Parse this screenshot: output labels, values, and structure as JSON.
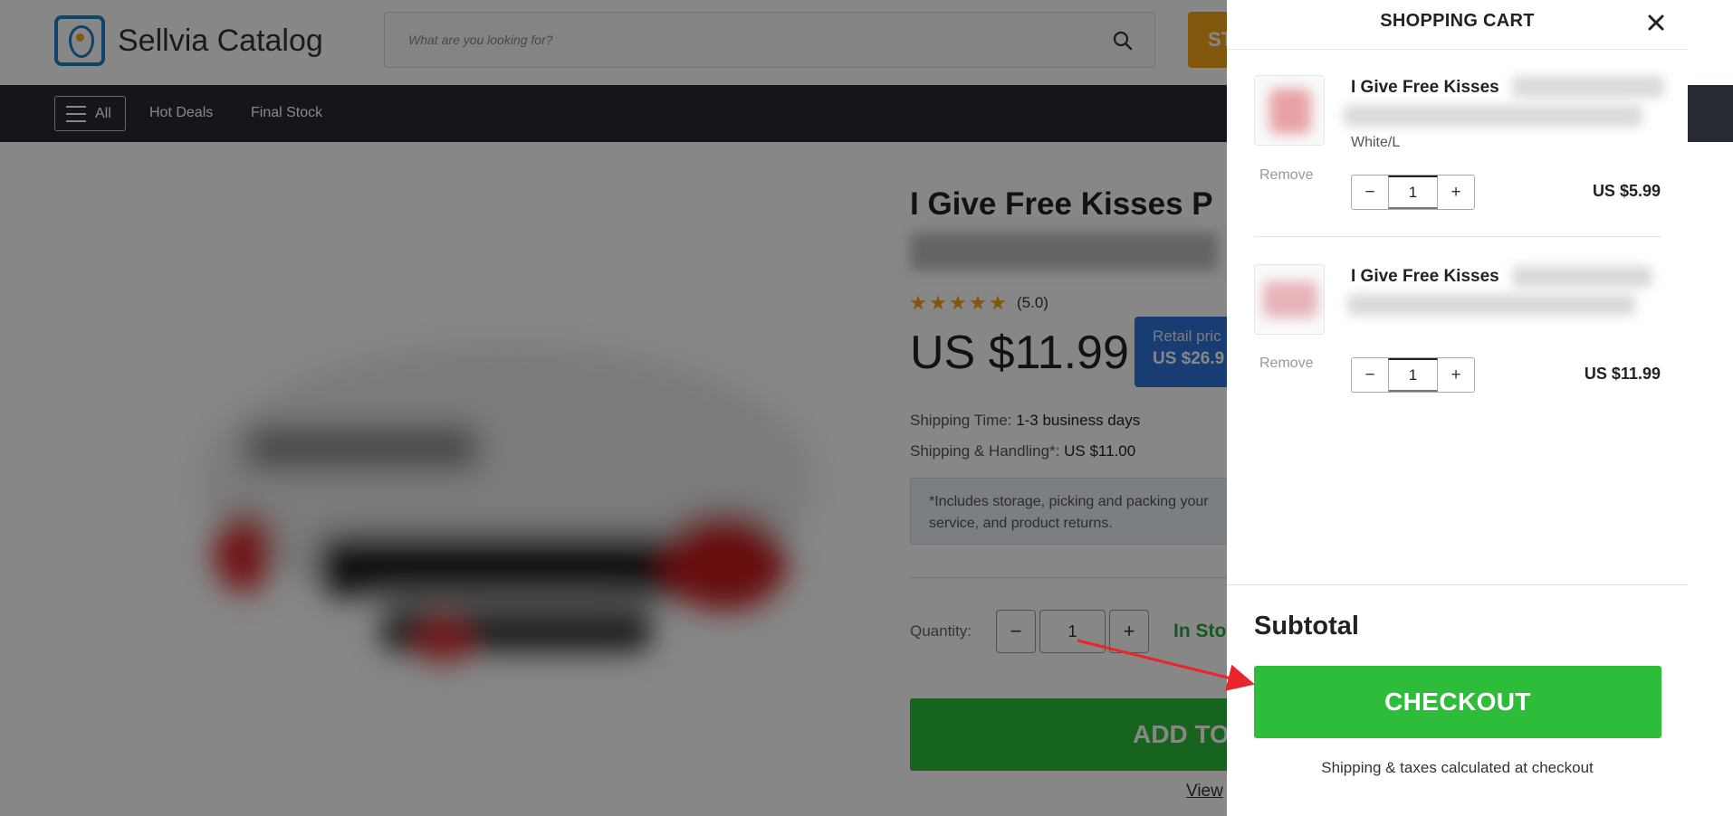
{
  "header": {
    "brand": "Sellvia Catalog",
    "search_placeholder": "What are you looking for?",
    "store_button_partial": "ST"
  },
  "nav": {
    "all_label": "All",
    "links": [
      "Hot Deals",
      "Final Stock"
    ]
  },
  "product": {
    "title_visible": "I Give Free Kisses P",
    "rating": "(5.0)",
    "stars": 5,
    "price": "US $11.99",
    "retail_label": "Retail pric",
    "retail_price": "US $26.9",
    "shipping_time_label": "Shipping Time:",
    "shipping_time": "1-3 business days",
    "shipping_handling_label": "Shipping & Handling*:",
    "shipping_handling": "US $11.00",
    "note_line1": "*Includes storage, picking and packing your",
    "note_line2": "service, and product returns.",
    "quantity_label": "Quantity:",
    "quantity_value": "1",
    "stock_status": "In Sto",
    "add_button": "ADD TO",
    "view_link": "View"
  },
  "cart": {
    "title": "SHOPPING CART",
    "items": [
      {
        "name": "I Give Free Kisses",
        "variant": "White/L",
        "quantity": "1",
        "price": "US $5.99",
        "remove_label": "Remove"
      },
      {
        "name": "I Give Free Kisses",
        "variant": "",
        "quantity": "1",
        "price": "US $11.99",
        "remove_label": "Remove"
      }
    ],
    "subtotal_label": "Subtotal",
    "checkout_label": "CHECKOUT",
    "shipping_note": "Shipping & taxes calculated at checkout"
  },
  "colors": {
    "brand_blue": "#1d7fc4",
    "accent_orange": "#f3a51b",
    "checkout_green": "#2dbd3a",
    "nav_dark": "#262b33",
    "annotation_red": "#e8262b"
  }
}
